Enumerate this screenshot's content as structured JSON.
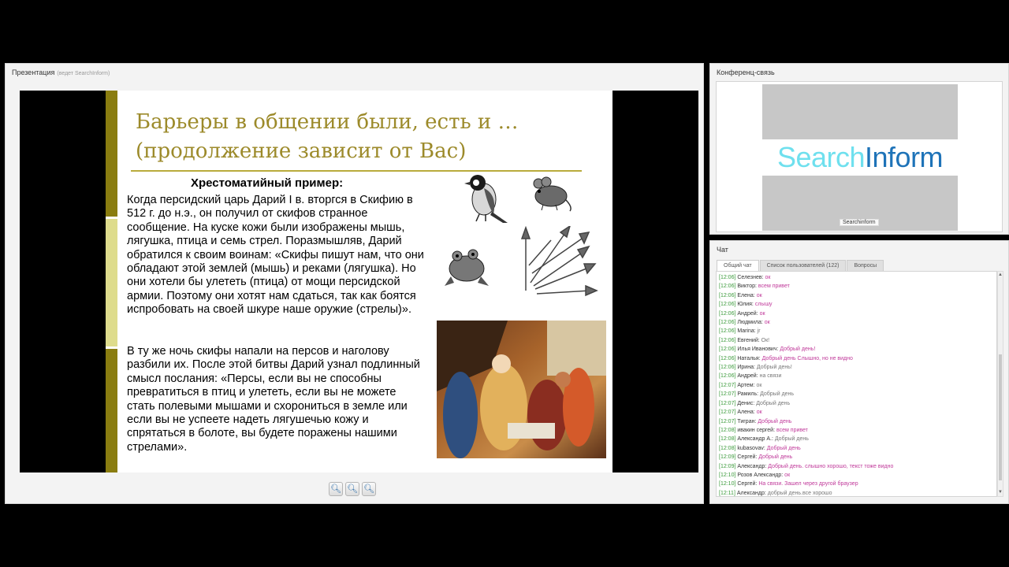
{
  "presentation": {
    "title": "Презентация",
    "subtitle": "(ведет SearchInform)",
    "slide": {
      "title_line1": "Барьеры в общении были, есть и …",
      "title_line2": "(продолжение зависит от Вас)",
      "example_title": "Хрестоматийный пример:",
      "paragraph1": "Когда персидский царь Дарий I в. вторгся в Скифию в 512 г. до н.э., он получил от скифов странное сообщение. На куске кожи были изображены мышь, лягушка, птица и семь стрел. Поразмышляв, Дарий обратился к своим воинам: «Скифы пишут нам, что они обладают этой землей (мышь) и реками (лягушка). Но они хотели бы улететь (птица) от мощи персидской армии. Поэтому они хотят нам сдаться, так как боятся испробовать на своей шкуре наше оружие (стрелы)».",
      "paragraph2": "В ту же ночь скифы напали на персов и наголову разбили их. После этой битвы Дарий узнал подлинный смысл послания: «Персы, если вы не способны превратиться в птиц и улететь, если вы не можете стать полевыми мышами и схорониться в земле или если вы не успеете надеть лягушечью кожу и спрятаться в болоте, вы будете поражены нашими стрелами»."
    }
  },
  "conference": {
    "title": "Конференц-связь",
    "logo_part1": "Search",
    "logo_part2": "Inform",
    "camera_label": "Searchinform"
  },
  "chat": {
    "title": "Чат",
    "tabs": [
      "Общий чат",
      "Список пользователей (122)",
      "Вопросы"
    ],
    "messages": [
      {
        "time": "[12:06]",
        "name": "Селезнев:",
        "text": "ок",
        "hl": true
      },
      {
        "time": "[12:06]",
        "name": "Виктор:",
        "text": "всем привет",
        "hl": true
      },
      {
        "time": "[12:06]",
        "name": "Елена:",
        "text": "ок",
        "hl": true
      },
      {
        "time": "[12:06]",
        "name": "Юлия:",
        "text": "слышу",
        "hl": true
      },
      {
        "time": "[12:06]",
        "name": "Андрей:",
        "text": "ок",
        "hl": true
      },
      {
        "time": "[12:06]",
        "name": "Людмила:",
        "text": "ок",
        "hl": true
      },
      {
        "time": "[12:06]",
        "name": "Marina:",
        "text": "jr",
        "hl": false
      },
      {
        "time": "[12:06]",
        "name": "Евгений:",
        "text": "Ок!",
        "hl": false
      },
      {
        "time": "[12:06]",
        "name": "Илья Иванович:",
        "text": "Добрый день!",
        "hl": true
      },
      {
        "time": "[12:06]",
        "name": "Наталья:",
        "text": "Добрый день Слышно, но не видно",
        "hl": true
      },
      {
        "time": "[12:06]",
        "name": "Ирина:",
        "text": "Добрый день!",
        "hl": false
      },
      {
        "time": "[12:06]",
        "name": "Андрей:",
        "text": "на связи",
        "hl": false
      },
      {
        "time": "[12:07]",
        "name": "Артем:",
        "text": "ок",
        "hl": false
      },
      {
        "time": "[12:07]",
        "name": "Рамиль:",
        "text": "Добрый день",
        "hl": false
      },
      {
        "time": "[12:07]",
        "name": "Денис:",
        "text": "Добрый день",
        "hl": false
      },
      {
        "time": "[12:07]",
        "name": "Алена:",
        "text": "ок",
        "hl": true
      },
      {
        "time": "[12:07]",
        "name": "Тигран:",
        "text": "Добрый день",
        "hl": true
      },
      {
        "time": "[12:08]",
        "name": "ивакин сергей:",
        "text": "всем привет",
        "hl": true
      },
      {
        "time": "[12:08]",
        "name": "Александр А.:",
        "text": "Добрый день",
        "hl": false
      },
      {
        "time": "[12:08]",
        "name": "kubasovav:",
        "text": "Добрый день",
        "hl": true
      },
      {
        "time": "[12:09]",
        "name": "Сергей:",
        "text": "Добрый день",
        "hl": true
      },
      {
        "time": "[12:09]",
        "name": "Александр:",
        "text": "Добрый день. слышно хорошо, текст тоже видно",
        "hl": true
      },
      {
        "time": "[12:10]",
        "name": "Розов Александр:",
        "text": "ок",
        "hl": true
      },
      {
        "time": "[12:10]",
        "name": "Сергей:",
        "text": "На связи. Зашел через другой браузер",
        "hl": true
      },
      {
        "time": "[12:11]",
        "name": "Александр:",
        "text": "добрый день.все хорошо",
        "hl": false
      }
    ]
  },
  "colors": {
    "slide_accent_dark": "#8a7d10",
    "slide_accent_light": "#dedc8c",
    "slide_title": "#9c8a2a",
    "chat_time": "#3a9a3a",
    "chat_highlight": "#c0399a"
  },
  "icons": [
    "zoom-in-icon",
    "zoom-reset-icon",
    "zoom-out-icon",
    "bird-illustration",
    "mouse-illustration",
    "frog-illustration",
    "arrows-illustration",
    "painting-illustration"
  ]
}
